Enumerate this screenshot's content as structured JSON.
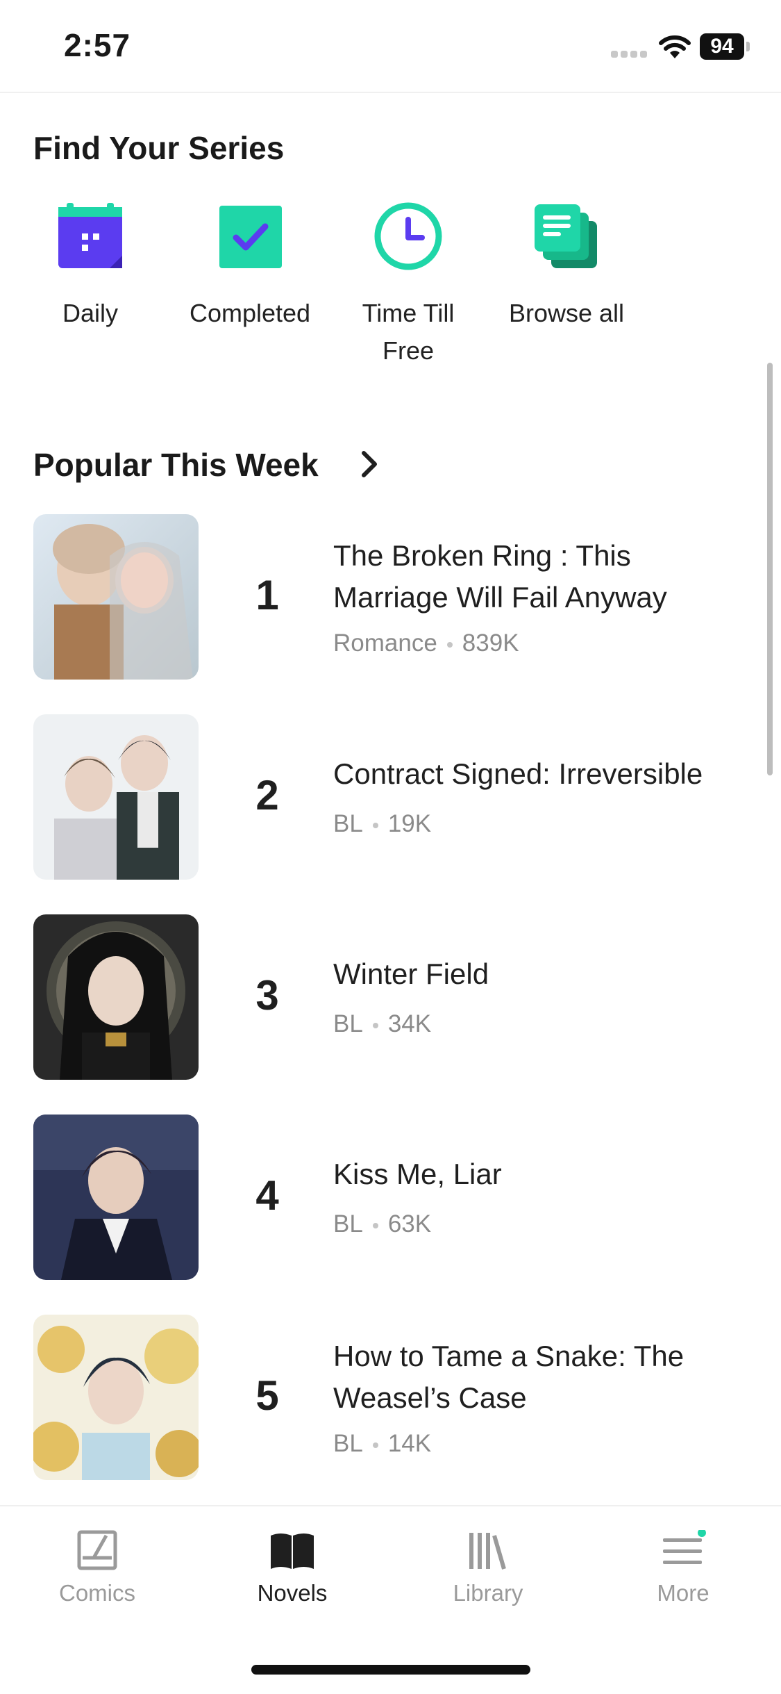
{
  "status": {
    "time": "2:57",
    "battery": "94"
  },
  "find": {
    "title": "Find Your Series",
    "categories": [
      {
        "label": "Daily",
        "icon": "calendar-icon"
      },
      {
        "label": "Completed",
        "icon": "check-square-icon"
      },
      {
        "label": "Time Till Free",
        "icon": "clock-icon"
      },
      {
        "label": "Browse all",
        "icon": "stacked-pages-icon"
      }
    ]
  },
  "popular": {
    "title": "Popular This Week",
    "items": [
      {
        "rank": "1",
        "title": "The Broken Ring : This Marriage Will Fail Anyway",
        "genre": "Romance",
        "views": "839K"
      },
      {
        "rank": "2",
        "title": "Contract Signed: Irreversible",
        "genre": "BL",
        "views": "19K"
      },
      {
        "rank": "3",
        "title": "Winter Field",
        "genre": "BL",
        "views": "34K"
      },
      {
        "rank": "4",
        "title": "Kiss Me, Liar",
        "genre": "BL",
        "views": "63K"
      },
      {
        "rank": "5",
        "title": "How to Tame a Snake: The Weasel’s Case",
        "genre": "BL",
        "views": "14K"
      }
    ]
  },
  "tabs": [
    {
      "label": "Comics",
      "icon": "comics-icon",
      "active": false
    },
    {
      "label": "Novels",
      "icon": "open-book-icon",
      "active": true
    },
    {
      "label": "Library",
      "icon": "library-icon",
      "active": false
    },
    {
      "label": "More",
      "icon": "menu-icon",
      "active": false,
      "badge": true
    }
  ],
  "colors": {
    "accent": "#1fd6a8",
    "purple": "#5b3cf0",
    "text": "#1f1f1f",
    "muted": "#8a8a8a"
  }
}
